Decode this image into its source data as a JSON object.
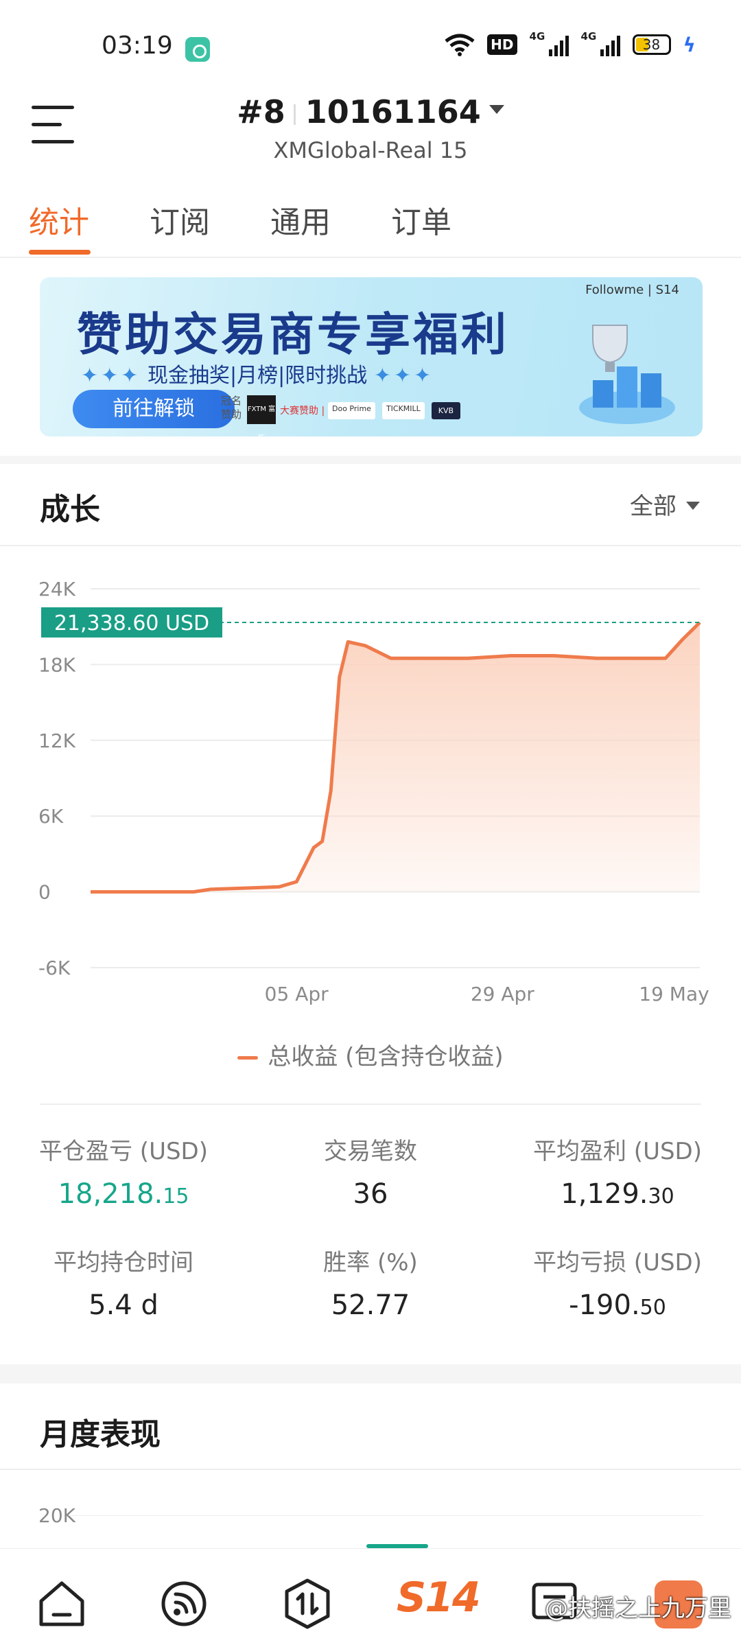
{
  "status_bar": {
    "time": "03:19",
    "battery": "38",
    "hd_label": "HD",
    "net_label_1": "4G",
    "net_label_2": "4G"
  },
  "header": {
    "rank": "#8",
    "account_id": "10161164",
    "server": "XMGlobal-Real 15"
  },
  "tabs": [
    {
      "label": "统计",
      "active": true
    },
    {
      "label": "订阅",
      "active": false
    },
    {
      "label": "通用",
      "active": false
    },
    {
      "label": "订单",
      "active": false
    }
  ],
  "banner": {
    "title": "赞助交易商专享福利",
    "subtitle": "现金抽奖|月榜|限时挑战",
    "dots": "✦✦✦",
    "button": "前往解锁",
    "sponsor_label": "冠名赞助",
    "fxtm": "FXTM 富拓",
    "sponsor_text": "大赛赞助 |",
    "logos": [
      "Doo Prime",
      "TICKMILL",
      "KVB"
    ],
    "brand": "Followme | S14"
  },
  "growth": {
    "title": "成长",
    "filter": "全部",
    "legend": "总收益 (包含持仓收益)",
    "current_label": "21,338.60 USD"
  },
  "chart_data": {
    "type": "area",
    "x": [
      "2024-03-12",
      "2024-03-18",
      "2024-03-24",
      "2024-03-26",
      "2024-03-30",
      "2024-04-01",
      "2024-04-03",
      "2024-04-05",
      "2024-04-07",
      "2024-04-08",
      "2024-04-09",
      "2024-04-10",
      "2024-04-11",
      "2024-04-13",
      "2024-04-16",
      "2024-04-20",
      "2024-04-25",
      "2024-04-30",
      "2024-05-05",
      "2024-05-10",
      "2024-05-15",
      "2024-05-18",
      "2024-05-20",
      "2024-05-22"
    ],
    "values": [
      0,
      0,
      0,
      200,
      300,
      350,
      400,
      800,
      3500,
      4000,
      8000,
      17000,
      19800,
      19500,
      18500,
      18500,
      18500,
      18700,
      18700,
      18500,
      18500,
      18500,
      20000,
      21338.6
    ],
    "y_ticks": [
      "24K",
      "18K",
      "12K",
      "6K",
      "0",
      "-6K"
    ],
    "ylim": [
      -6000,
      24000
    ],
    "x_ticks": [
      "05 Apr",
      "29 Apr",
      "19 May"
    ],
    "last_value_label": "21,338.60 USD",
    "colors": {
      "line": "#ef7b4c",
      "fill": "#fbd1bd",
      "label_bg": "#1a9e86"
    }
  },
  "stats": [
    {
      "label": "平仓盈亏 (USD)",
      "int": "18,218.",
      "dec": "15",
      "highlight": true
    },
    {
      "label": "交易笔数",
      "int": "36",
      "dec": "",
      "highlight": false
    },
    {
      "label": "平均盈利 (USD)",
      "int": "1,129.",
      "dec": "30",
      "highlight": false
    },
    {
      "label": "平均持仓时间",
      "int": "5.4 d",
      "dec": "",
      "highlight": false
    },
    {
      "label": "胜率 (%)",
      "int": "52.77",
      "dec": "",
      "highlight": false
    },
    {
      "label": "平均亏损 (USD)",
      "int": "-190.",
      "dec": "50",
      "highlight": false
    }
  ],
  "monthly": {
    "title": "月度表现",
    "tick": "20K"
  },
  "bottom_nav": {
    "s14": "S14",
    "badge_icon": "gift-icon"
  },
  "watermark": "@扶摇之上九万里"
}
